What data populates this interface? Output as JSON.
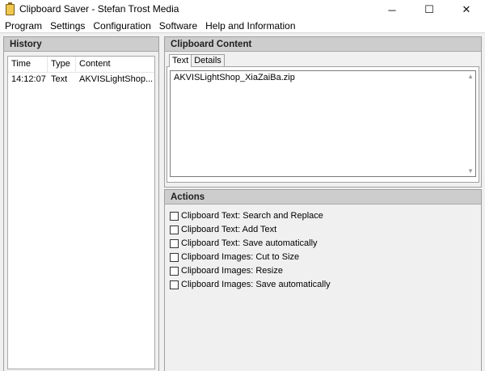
{
  "window": {
    "title": "Clipboard Saver - Stefan Trost Media",
    "minimize_glyph": "─",
    "maximize_glyph": "☐",
    "close_glyph": "✕"
  },
  "menu": [
    "Program",
    "Settings",
    "Configuration",
    "Software",
    "Help and Information"
  ],
  "history": {
    "title": "History",
    "columns": [
      "Time",
      "Type",
      "Content"
    ],
    "rows": [
      {
        "time": "14:12:07",
        "type": "Text",
        "content": "AKVISLightShop..."
      }
    ]
  },
  "clipboard": {
    "title": "Clipboard Content",
    "tabs": [
      "Text",
      "Details"
    ],
    "active_tab": "Text",
    "text": "AKVISLightShop_XiaZaiBa.zip"
  },
  "actions": {
    "title": "Actions",
    "items": [
      {
        "label": "Clipboard Text: Search and Replace",
        "checked": false
      },
      {
        "label": "Clipboard Text: Add Text",
        "checked": false
      },
      {
        "label": "Clipboard Text: Save automatically",
        "checked": false
      },
      {
        "label": "Clipboard Images: Cut to Size",
        "checked": false
      },
      {
        "label": "Clipboard Images: Resize",
        "checked": false
      },
      {
        "label": "Clipboard Images: Save automatically",
        "checked": false
      }
    ]
  }
}
